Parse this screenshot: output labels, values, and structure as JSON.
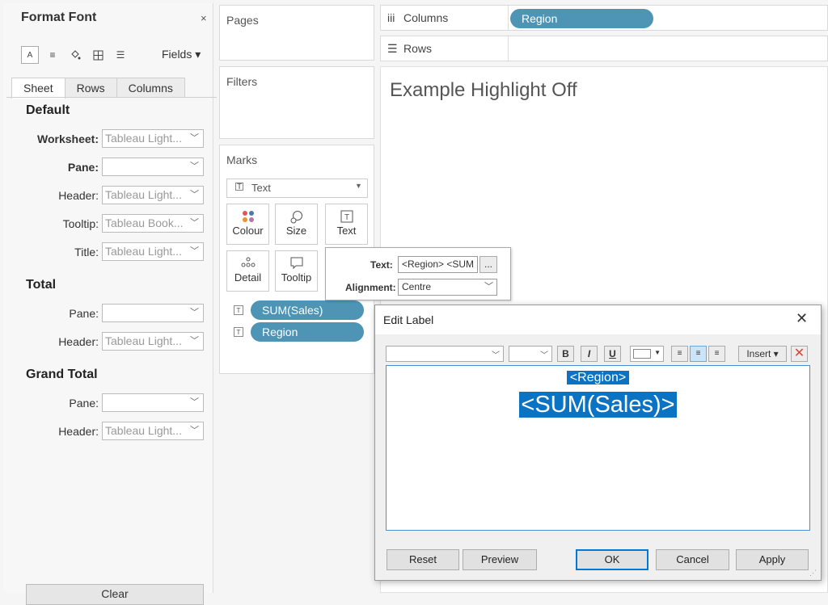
{
  "format_font": {
    "title": "Format Font",
    "close": "×",
    "fields_label": "Fields ▾",
    "tabs": [
      "Sheet",
      "Rows",
      "Columns"
    ],
    "default_section": "Default",
    "default_rows": [
      {
        "label": "Worksheet:",
        "value": "Tableau Light..."
      },
      {
        "label": "Pane:",
        "value": ""
      },
      {
        "label": "Header:",
        "value": "Tableau Light..."
      },
      {
        "label": "Tooltip:",
        "value": "Tableau Book..."
      },
      {
        "label": "Title:",
        "value": "Tableau Light..."
      }
    ],
    "total_section": "Total",
    "total_rows": [
      {
        "label": "Pane:",
        "value": ""
      },
      {
        "label": "Header:",
        "value": "Tableau Light..."
      }
    ],
    "grand_total_section": "Grand Total",
    "grand_total_rows": [
      {
        "label": "Pane:",
        "value": ""
      },
      {
        "label": "Header:",
        "value": "Tableau Light..."
      }
    ],
    "clear_label": "Clear"
  },
  "pages": {
    "title": "Pages"
  },
  "filters": {
    "title": "Filters"
  },
  "marks": {
    "title": "Marks",
    "type": "Text",
    "buttons": [
      "Colour",
      "Size",
      "Text",
      "Detail",
      "Tooltip"
    ],
    "pills": [
      "SUM(Sales)",
      "Region"
    ]
  },
  "shelves": {
    "columns_label": "Columns",
    "columns_pill": "Region",
    "rows_label": "Rows"
  },
  "view": {
    "title": "Example Highlight Off"
  },
  "text_popup": {
    "text_label": "Text:",
    "text_value": "<Region> <SUM",
    "more": "...",
    "alignment_label": "Alignment:",
    "alignment_value": "Centre"
  },
  "edit_label": {
    "title": "Edit Label",
    "close": "✕",
    "insert_label": "Insert ▾",
    "line1": "<Region>",
    "line2": "<SUM(Sales)>",
    "buttons": {
      "reset": "Reset",
      "preview": "Preview",
      "ok": "OK",
      "cancel": "Cancel",
      "apply": "Apply"
    }
  },
  "colors": {
    "pill": "#4e94b5",
    "selection": "#0a73c4",
    "accent_border": "#0078d7"
  }
}
